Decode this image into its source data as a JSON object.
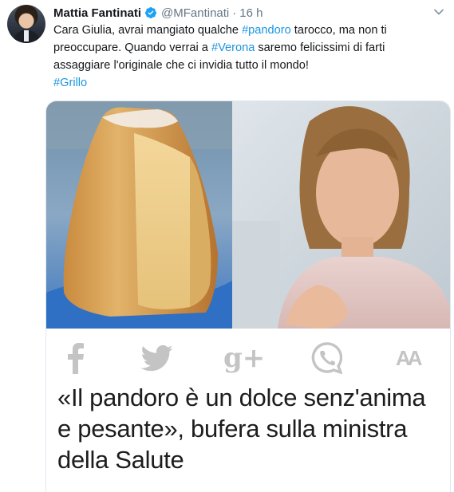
{
  "tweet": {
    "author_name": "Mattia Fantinati",
    "handle": "@MFantinati",
    "time": "16 h",
    "text": {
      "p1": "Cara Giulia, avrai mangiato qualche ",
      "tag_pandoro": "#pandoro",
      "p2": " tarocco, ma non ti preoccupare. Quando verrai a ",
      "tag_verona": "#Verona",
      "p3": " saremo felicissimi di farti assaggiare l'originale che ci invidia tutto il mondo!",
      "tag_grillo": "#Grillo"
    }
  },
  "card": {
    "share_icons": [
      "facebook-icon",
      "twitter-icon",
      "google-plus-icon",
      "whatsapp-icon",
      "text-size-icon"
    ],
    "google_plus_label": "g+",
    "text_size_label": "AA",
    "headline": "«Il pandoro è un dolce senz'anima e pesante», bufera sulla ministra della Salute"
  },
  "colors": {
    "link": "#1b95e0",
    "verified": "#1da1f2",
    "muted": "#657786",
    "share_icon": "#c4c4c4"
  }
}
